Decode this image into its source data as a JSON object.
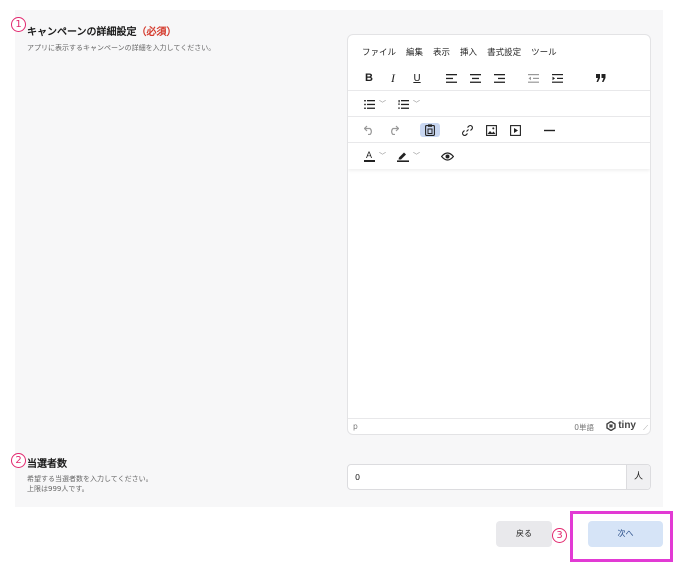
{
  "detail_section": {
    "marker": "1",
    "title": "キャンペーンの詳細設定",
    "required_label": "（必須）",
    "help": "アプリに表示するキャンペーンの詳細を入力してください。"
  },
  "editor": {
    "menu": [
      "ファイル",
      "編集",
      "表示",
      "挿入",
      "書式設定",
      "ツール"
    ],
    "toolbar": {
      "bold": "B",
      "italic": "I",
      "underline": "U",
      "text_color_glyph": "A"
    },
    "status": {
      "path": "p",
      "word_count": "0単語",
      "brand": "tiny"
    }
  },
  "winners_section": {
    "marker": "2",
    "title": "当選者数",
    "help_line1": "希望する当選者数を入力してください。",
    "help_line2": "上限は999人です。",
    "input_value": "0",
    "unit": "人"
  },
  "footer": {
    "marker": "3",
    "back_label": "戻る",
    "next_label": "次へ"
  },
  "colors": {
    "marker": "#e2286f",
    "required": "#d43a2c",
    "highlight": "#e23ad4",
    "next_button": "#d6e4f7"
  }
}
